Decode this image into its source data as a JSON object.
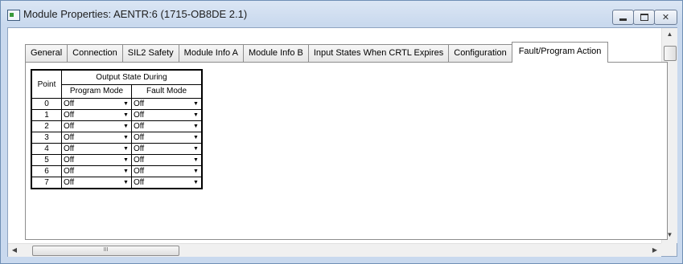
{
  "window": {
    "title": "Module Properties: AENTR:6 (1715-OB8DE 2.1)",
    "controls": {
      "minimize": "",
      "maximize": "",
      "close": "✕"
    }
  },
  "tabs": [
    {
      "label": "General",
      "active": false
    },
    {
      "label": "Connection",
      "active": false
    },
    {
      "label": "SIL2 Safety",
      "active": false
    },
    {
      "label": "Module Info A",
      "active": false
    },
    {
      "label": "Module Info B",
      "active": false
    },
    {
      "label": "Input States When CRTL Expires",
      "active": false
    },
    {
      "label": "Configuration",
      "active": false
    },
    {
      "label": "Fault/Program Action",
      "active": true
    }
  ],
  "table": {
    "point_header": "Point",
    "group_header": "Output State During",
    "program_header": "Program Mode",
    "fault_header": "Fault Mode",
    "rows": [
      {
        "point": "0",
        "program": "Off",
        "fault": "Off"
      },
      {
        "point": "1",
        "program": "Off",
        "fault": "Off"
      },
      {
        "point": "2",
        "program": "Off",
        "fault": "Off"
      },
      {
        "point": "3",
        "program": "Off",
        "fault": "Off"
      },
      {
        "point": "4",
        "program": "Off",
        "fault": "Off"
      },
      {
        "point": "5",
        "program": "Off",
        "fault": "Off"
      },
      {
        "point": "6",
        "program": "Off",
        "fault": "Off"
      },
      {
        "point": "7",
        "program": "Off",
        "fault": "Off"
      }
    ]
  },
  "scrollbars": {
    "vertical_up": "▲",
    "vertical_down": "▼",
    "horizontal_left": "◀",
    "horizontal_right": "▶",
    "thumb_grip": "III"
  }
}
